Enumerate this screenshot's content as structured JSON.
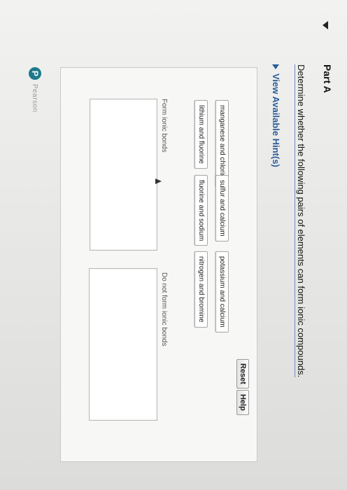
{
  "part": {
    "title": "Part A"
  },
  "question": "Determine whether the following pairs of elements can form ionic compounds.",
  "hints_label": "View Available Hint(s)",
  "buttons": {
    "reset": "Reset",
    "help": "Help"
  },
  "pairs": [
    "manganese and chlorine",
    "sulfur and calcium",
    "potassium and calcium",
    "lithium and fluorine",
    "fluorine and sodium",
    "nitrogen and bromine"
  ],
  "zones": {
    "form": "Form ionic bonds",
    "not_form": "Do not form ionic bonds"
  },
  "logo": {
    "letter": "P",
    "text": "Pearson"
  }
}
